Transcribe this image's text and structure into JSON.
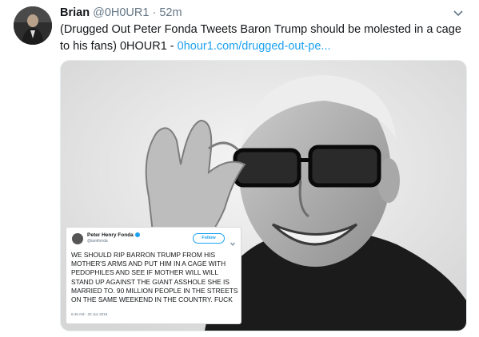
{
  "tweet": {
    "author_name": "Brian",
    "author_handle": "@0H0UR1",
    "separator": "·",
    "timestamp": "52m",
    "text": "(Drugged Out Peter Fonda Tweets Baron Trump should be molested in a cage to his fans) 0HOUR1 - ",
    "link_text": "0hour1.com/drugged-out-pe..."
  },
  "embedded_tweet": {
    "name": "Peter Henry Fonda",
    "handle": "@iamfonda",
    "follow_label": "Follow",
    "text": "WE SHOULD RIP BARRON TRUMP FROM HIS MOTHER'S ARMS AND PUT HIM IN A CAGE WITH PEDOPHILES AND SEE IF MOTHER WILL WILL STAND UP AGAINST THE GIANT ASSHOLE SHE IS MARRIED TO. 90 MILLION PEOPLE IN THE STREETS ON THE SAME WEEKEND IN THE COUNTRY. FUCK",
    "timestamp": "6:48 AM - 20 Jun 2018"
  },
  "colors": {
    "link": "#1da1f2",
    "secondary_text": "#657786",
    "border": "#e6ecf0"
  },
  "icons": {
    "menu": "chevron-down-icon",
    "verified": "verified-badge-icon"
  }
}
